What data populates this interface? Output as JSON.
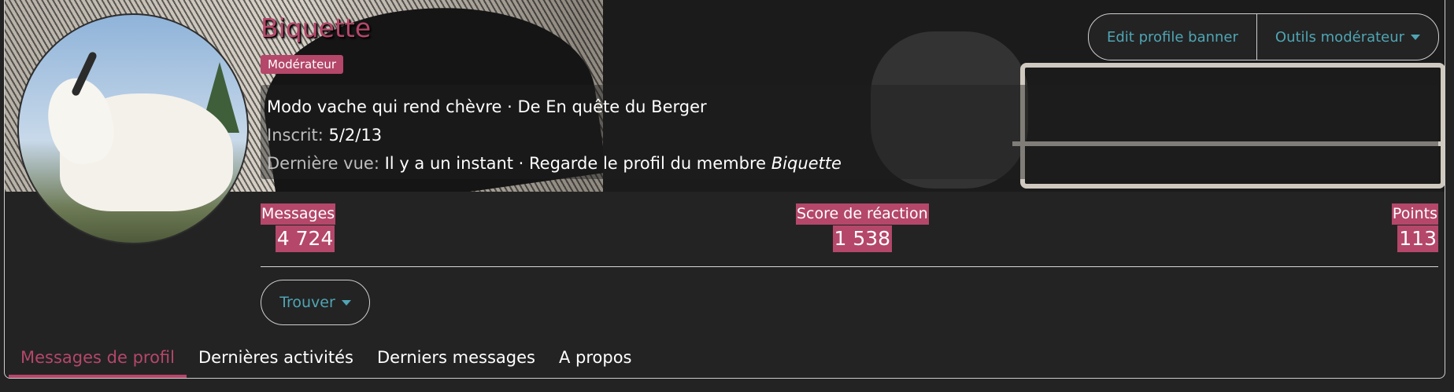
{
  "profile": {
    "name": "Biquette",
    "badge": "Modérateur",
    "tagline": "Modo vache qui rend chèvre · De En quête du Berger",
    "joined_label": "Inscrit:",
    "joined_value": "5/2/13",
    "last_seen_label": "Dernière vue:",
    "last_seen_value": "Il y a un instant · Regarde le profil du membre",
    "last_seen_member": "Biquette"
  },
  "actions": {
    "edit_banner": "Edit profile banner",
    "mod_tools": "Outils modérateur",
    "find": "Trouver"
  },
  "stats": {
    "messages_label": "Messages",
    "messages_value": "4 724",
    "reaction_label": "Score de réaction",
    "reaction_value": "1 538",
    "points_label": "Points",
    "points_value": "113"
  },
  "tabs": [
    {
      "label": "Messages de profil",
      "active": true
    },
    {
      "label": "Dernières activités",
      "active": false
    },
    {
      "label": "Derniers messages",
      "active": false
    },
    {
      "label": "A propos",
      "active": false
    }
  ],
  "colors": {
    "accent": "#b4476a",
    "link": "#4fa5b4",
    "background": "#232323"
  },
  "icons": [
    "chevron-down-icon"
  ]
}
